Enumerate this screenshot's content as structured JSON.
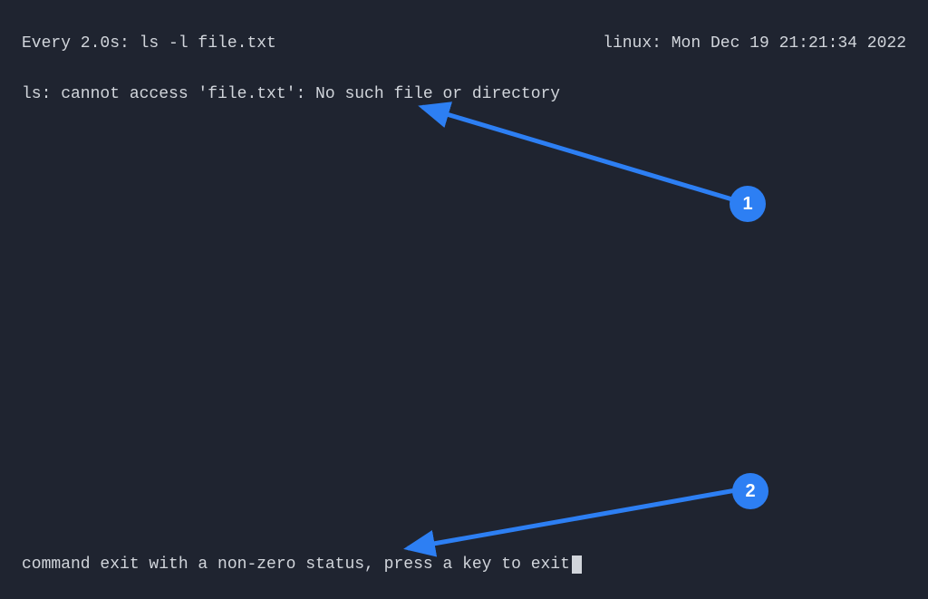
{
  "header": {
    "left": "Every 2.0s: ls -l file.txt",
    "right": "linux: Mon Dec 19 21:21:34 2022"
  },
  "error": "ls: cannot access 'file.txt': No such file or directory",
  "footer": "command exit with a non-zero status, press a key to exit",
  "annotations": {
    "badge1": "1",
    "badge2": "2"
  },
  "colors": {
    "background": "#1f2430",
    "text": "#d1d5db",
    "accent": "#2d7ff3"
  }
}
